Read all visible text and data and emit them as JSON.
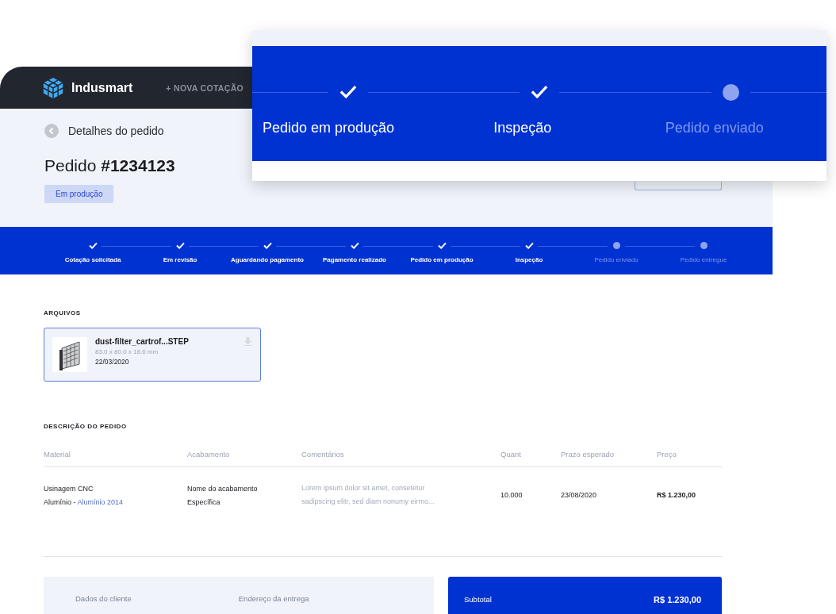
{
  "header": {
    "brand": "Indusmart",
    "nav_link": "+ NOVA COTAÇÃO"
  },
  "page": {
    "back_label": "Detalhes do pedido",
    "title_prefix": "Pedido",
    "order_number": "#1234123",
    "status_badge": "Em produção"
  },
  "progress": [
    {
      "label": "Cotação solicitada",
      "done": true
    },
    {
      "label": "Em revisão",
      "done": true
    },
    {
      "label": "Aguardando pagamento",
      "done": true
    },
    {
      "label": "Pagamento realizado",
      "done": true
    },
    {
      "label": "Pedido em produção",
      "done": true
    },
    {
      "label": "Inspeção",
      "done": true
    },
    {
      "label": "Pedido enviado",
      "done": false
    },
    {
      "label": "Pedido entregue",
      "done": false
    }
  ],
  "zoom_overlay": {
    "steps": [
      {
        "label": "Pedido em produção",
        "done": true
      },
      {
        "label": "Inspeção",
        "done": true
      },
      {
        "label": "Pedido enviado",
        "done": false
      }
    ]
  },
  "files": {
    "heading": "ARQUIVOS",
    "items": [
      {
        "name": "dust-filter_cartrof...STEP",
        "dimensions": "83.0 x 80.0 x 18.6 mm",
        "date": "22/03/2020"
      }
    ]
  },
  "order_description": {
    "heading": "DESCRIÇÃO DO PEDIDO",
    "columns": [
      "Material",
      "Acabamento",
      "Comentários",
      "Quant",
      "Prazo esperado",
      "Preço"
    ],
    "rows": [
      {
        "material": "Usinagem CNC",
        "material_type": "Alumínio -",
        "material_grade": "Alumínio 2014",
        "finish": "Nome do acabamento",
        "finish_detail": "Específica",
        "comment": "Lorem ipsum dolor sit amet, consetetur sadipscing elitr, sed diam nonumy eirmo...",
        "quantity": "10.000",
        "due_date": "23/08/2020",
        "price": "R$ 1.230,00"
      }
    ]
  },
  "customer_panel": {
    "labels": [
      "Dados do cliente",
      "Endereço da entrega"
    ]
  },
  "summary_panel": {
    "label": "Subtotal",
    "value": "R$ 1.230,00"
  }
}
